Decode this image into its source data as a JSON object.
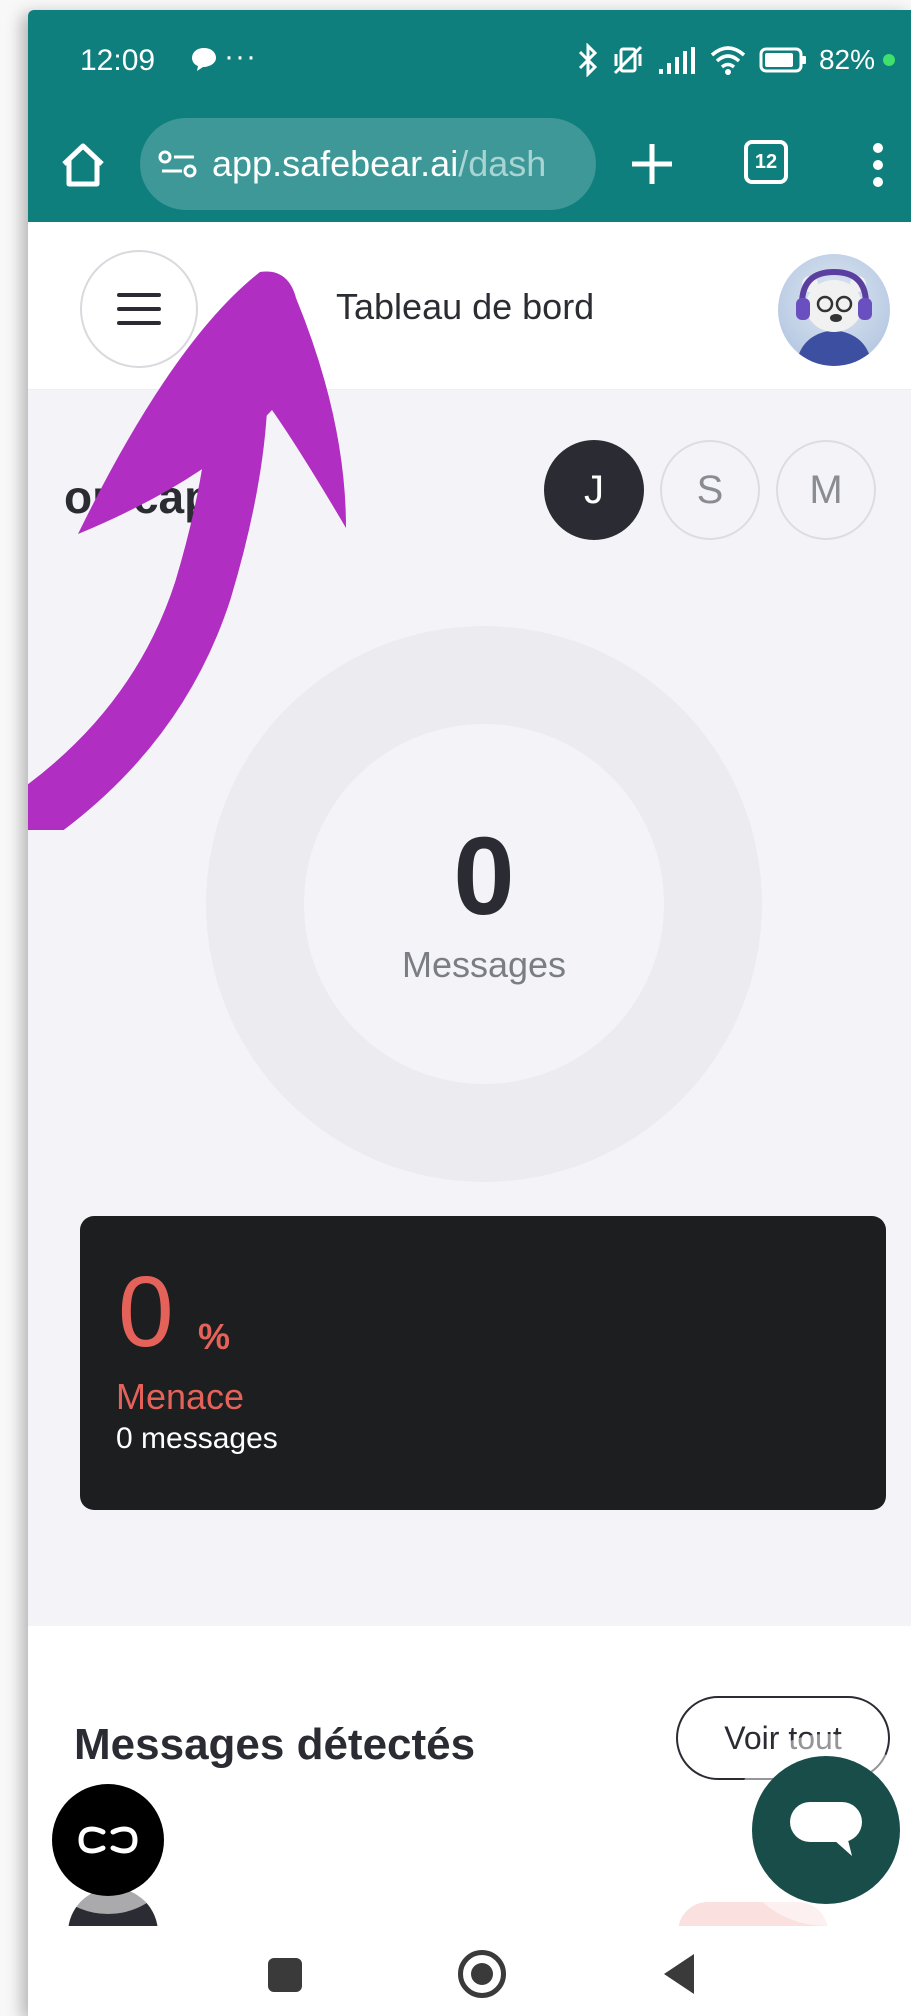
{
  "status_bar": {
    "time": "12:09",
    "overflow": "···",
    "battery": "82%",
    "icons": [
      "chat-bubble-icon",
      "bluetooth-icon",
      "vibrate-icon",
      "signal-icon",
      "wifi-icon",
      "battery-icon"
    ]
  },
  "browser": {
    "url_domain": "app.safebear.ai",
    "url_path": "/dash",
    "tab_count": "12",
    "theme_color": "#0f7f7e"
  },
  "header": {
    "title": "Tableau de bord"
  },
  "main": {
    "section_heading": "on cap",
    "period_tabs": [
      {
        "label": "J",
        "active": true
      },
      {
        "label": "S",
        "active": false
      },
      {
        "label": "M",
        "active": false
      }
    ],
    "summary": {
      "count": "0",
      "count_label": "Messages"
    },
    "threat": {
      "percent": "0",
      "percent_sign": "%",
      "label": "Menace",
      "messages": "0 messages",
      "accent_color": "#e5625b"
    }
  },
  "messages": {
    "title": "Messages détectés",
    "see_all": "Voir tout"
  },
  "annotation": {
    "arrow_color": "#b02ec1"
  }
}
